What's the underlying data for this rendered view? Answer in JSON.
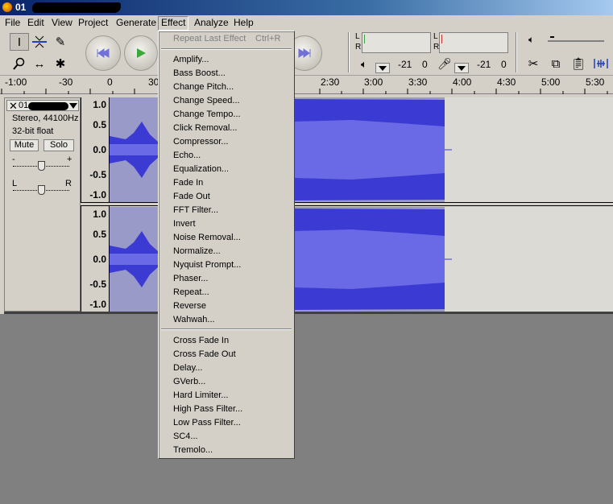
{
  "window": {
    "title": "01"
  },
  "menubar": [
    "File",
    "Edit",
    "View",
    "Project",
    "Generate",
    "Effect",
    "Analyze",
    "Help"
  ],
  "toolbar": {
    "meter_labels": {
      "l": "L",
      "r": "R"
    },
    "output_value": "-21",
    "output_zero": "0",
    "input_value": "-21",
    "input_zero": "0"
  },
  "ruler": {
    "labels": [
      "-1:00",
      "-30",
      "0",
      "30",
      "2:30",
      "3:00",
      "3:30",
      "4:00",
      "4:30",
      "5:00",
      "5:30"
    ]
  },
  "track": {
    "name": "01",
    "format": "Stereo, 44100Hz",
    "bits": "32-bit float",
    "mute": "Mute",
    "solo": "Solo",
    "gain_minus": "-",
    "gain_plus": "+",
    "pan_left": "L",
    "pan_right": "R",
    "scale": [
      "1.0",
      "0.5",
      "0.0",
      "-0.5",
      "-1.0"
    ]
  },
  "effect_menu": {
    "repeat_last": "Repeat Last Effect",
    "repeat_shortcut": "Ctrl+R",
    "group1": [
      "Amplify...",
      "Bass Boost...",
      "Change Pitch...",
      "Change Speed...",
      "Change Tempo...",
      "Click Removal...",
      "Compressor...",
      "Echo...",
      "Equalization...",
      "Fade In",
      "Fade Out",
      "FFT Filter...",
      "Invert",
      "Noise Removal...",
      "Normalize...",
      "Nyquist Prompt...",
      "Phaser...",
      "Repeat...",
      "Reverse",
      "Wahwah..."
    ],
    "group2": [
      "Cross Fade In",
      "Cross Fade Out",
      "Delay...",
      "GVerb...",
      "Hard Limiter...",
      "High Pass Filter...",
      "Low Pass Filter...",
      "SC4...",
      "Tremolo..."
    ]
  },
  "colors": {
    "waveform": "#3b3bd4",
    "waveform_rms": "#6a6ae6",
    "selection": "#9a9ac8"
  }
}
